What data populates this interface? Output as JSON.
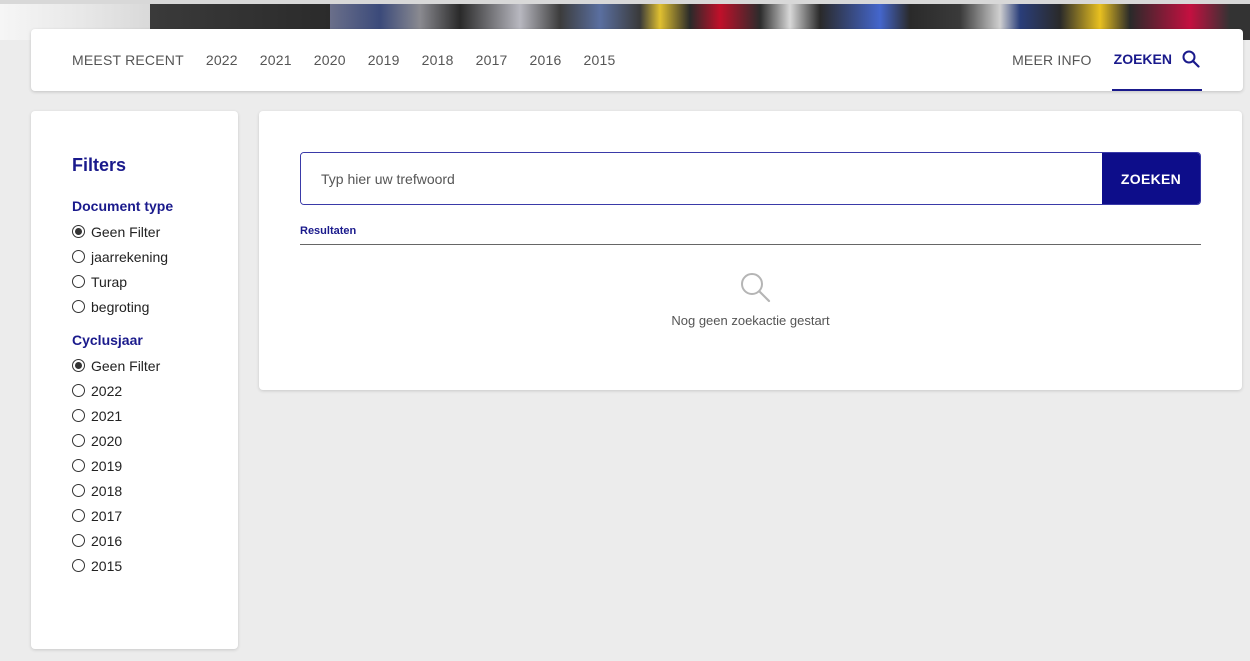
{
  "nav": {
    "items": [
      "MEEST RECENT",
      "2022",
      "2021",
      "2020",
      "2019",
      "2018",
      "2017",
      "2016",
      "2015"
    ],
    "more_info": "MEER INFO",
    "search": "ZOEKEN"
  },
  "filters": {
    "title": "Filters",
    "document_type": {
      "label": "Document type",
      "options": [
        "Geen Filter",
        "jaarrekening",
        "Turap",
        "begroting"
      ],
      "selected": "Geen Filter"
    },
    "cycle_year": {
      "label": "Cyclusjaar",
      "options": [
        "Geen Filter",
        "2022",
        "2021",
        "2020",
        "2019",
        "2018",
        "2017",
        "2016",
        "2015"
      ],
      "selected": "Geen Filter"
    }
  },
  "search": {
    "placeholder": "Typ hier uw trefwoord",
    "value": "",
    "button_label": "ZOEKEN"
  },
  "results": {
    "label": "Resultaten",
    "empty_message": "Nog geen zoekactie gestart"
  },
  "colors": {
    "accent": "#1a1a8c",
    "button": "#0d0d8a",
    "background": "#ececec"
  }
}
